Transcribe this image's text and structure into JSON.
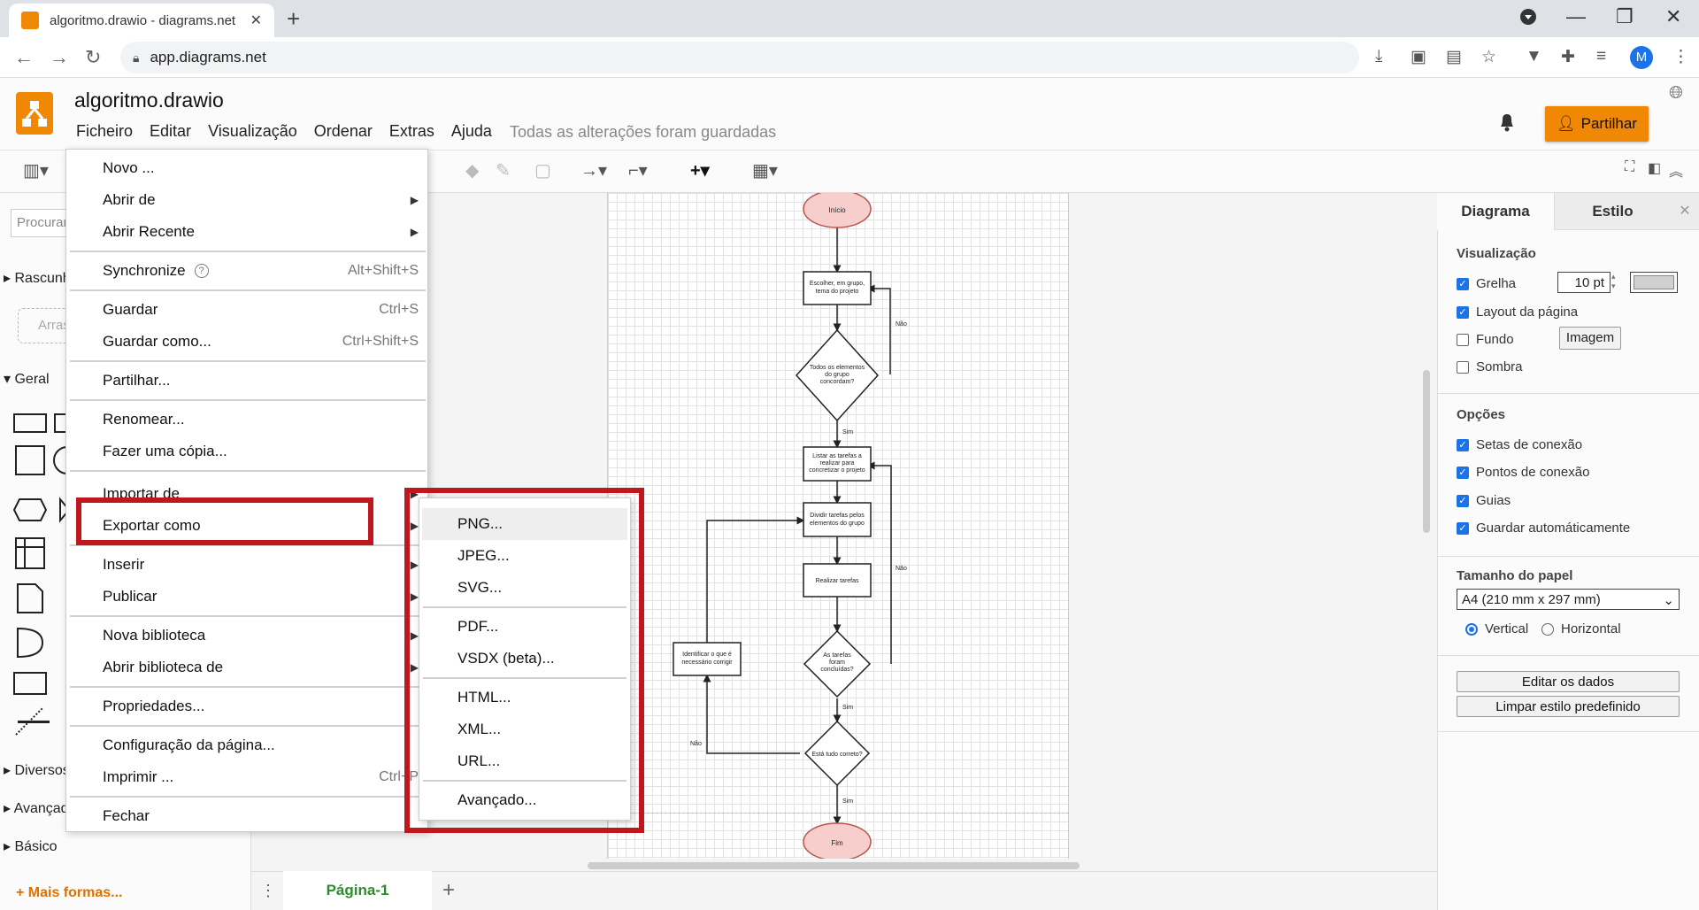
{
  "browser": {
    "tab_title": "algoritmo.drawio - diagrams.net",
    "tab_close": "✕",
    "new_tab": "+",
    "url": "app.diagrams.net",
    "profile_initial": "M"
  },
  "app": {
    "doc_title": "algoritmo.drawio",
    "menus": [
      "Ficheiro",
      "Editar",
      "Visualização",
      "Ordenar",
      "Extras",
      "Ajuda"
    ],
    "saved_status": "Todas as alterações foram guardadas",
    "share_label": "Partilhar"
  },
  "sidebar": {
    "search_placeholder": "Procurar",
    "scratchpad": "Rascunho",
    "scratch_hint": "Arrastar",
    "general": "Geral",
    "sections": [
      "Diversos",
      "Avançado",
      "Básico"
    ],
    "more_shapes": "+ Mais formas..."
  },
  "file_menu": {
    "items": [
      {
        "label": "Novo ...",
        "shortcut": ""
      },
      {
        "label": "Abrir de",
        "shortcut": ""
      },
      {
        "label": "Abrir Recente",
        "shortcut": ""
      },
      {
        "label": "Synchronize",
        "shortcut": "Alt+Shift+S"
      },
      {
        "label": "Guardar",
        "shortcut": "Ctrl+S"
      },
      {
        "label": "Guardar como...",
        "shortcut": "Ctrl+Shift+S"
      },
      {
        "label": "Partilhar...",
        "shortcut": ""
      },
      {
        "label": "Renomear...",
        "shortcut": ""
      },
      {
        "label": "Fazer uma cópia...",
        "shortcut": ""
      },
      {
        "label": "Importar de",
        "shortcut": ""
      },
      {
        "label": "Exportar como",
        "shortcut": ""
      },
      {
        "label": "Inserir",
        "shortcut": ""
      },
      {
        "label": "Publicar",
        "shortcut": ""
      },
      {
        "label": "Nova biblioteca",
        "shortcut": ""
      },
      {
        "label": "Abrir biblioteca de",
        "shortcut": ""
      },
      {
        "label": "Propriedades...",
        "shortcut": ""
      },
      {
        "label": "Configuração da página...",
        "shortcut": ""
      },
      {
        "label": "Imprimir ...",
        "shortcut": "Ctrl+P"
      },
      {
        "label": "Fechar",
        "shortcut": ""
      }
    ]
  },
  "export_menu": {
    "items": [
      "PNG...",
      "JPEG...",
      "SVG...",
      "PDF...",
      "VSDX (beta)...",
      "HTML...",
      "XML...",
      "URL...",
      "Avançado..."
    ]
  },
  "right_panel": {
    "tabs": [
      "Diagrama",
      "Estilo"
    ],
    "view_title": "Visualização",
    "grid": "Grelha",
    "grid_size": "10 pt",
    "page_layout": "Layout da página",
    "background": "Fundo",
    "image_button": "Imagem",
    "shadow": "Sombra",
    "options_title": "Opções",
    "connection_arrows": "Setas de conexão",
    "connection_points": "Pontos de conexão",
    "guides": "Guias",
    "autosave": "Guardar automáticamente",
    "paper_size_title": "Tamanho do papel",
    "paper_size": "A4 (210 mm x 297 mm)",
    "portrait": "Vertical",
    "landscape": "Horizontal",
    "edit_data": "Editar os dados",
    "clear_default_style": "Limpar estilo predefinido"
  },
  "page_tab": "Página-1",
  "flowchart": {
    "start": "Início",
    "step1": [
      "Escolher, em grupo,",
      "tema do projeto"
    ],
    "decision1": [
      "Todos os elementos",
      "do grupo",
      "concordam?"
    ],
    "step2": [
      "Listar as tarefas a",
      "realizar para",
      "concretizar o projeto"
    ],
    "step3": [
      "Dividir tarefas pelos",
      "elementos do grupo"
    ],
    "step4": "Realizar tarefas",
    "decision2": [
      "As tarefas",
      "foram",
      "concluídas?"
    ],
    "decision3": "Está tudo correto?",
    "fix": [
      "Identificar o que é",
      "necessário corrigir"
    ],
    "end": "Fim",
    "yes": "Sim",
    "no": "Não"
  }
}
